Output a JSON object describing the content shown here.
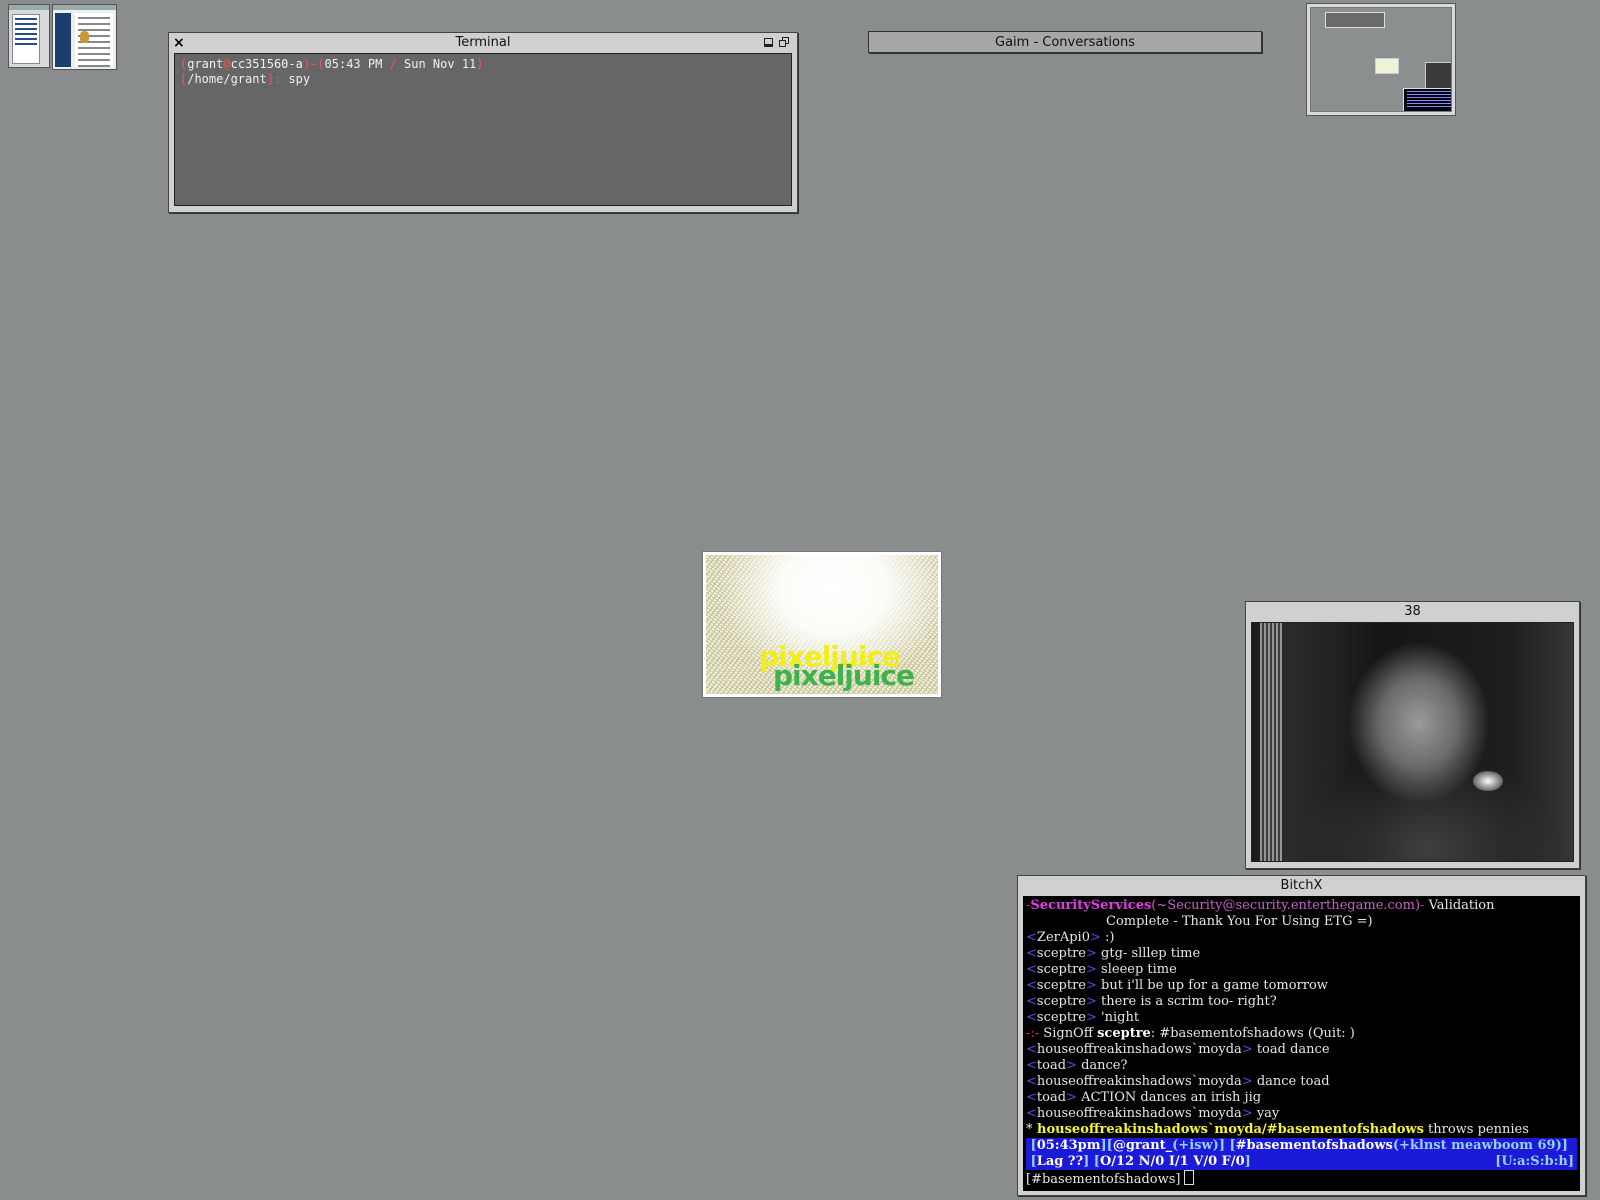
{
  "desktop": {
    "background_color": "#8a8d8e",
    "thumbnails": [
      "browser-thumbnail",
      "webpage-thumbnail"
    ]
  },
  "terminal": {
    "title": "Terminal",
    "line1": {
      "open": "(",
      "user": "grant",
      "at": "@",
      "host": "cc351560-a",
      "sep": ")-(",
      "time": "05:43 PM",
      "slash": " / ",
      "date": "Sun Nov 11",
      "close": ")"
    },
    "line2": {
      "open": "[",
      "path": "/home/grant",
      "close": "]:",
      "command": " spy"
    },
    "colors": {
      "screen": "#666666",
      "accent": "#e85a5a"
    }
  },
  "gaim": {
    "title": "Gaim - Conversations"
  },
  "pixeljuice": {
    "word1": "pixeljuice",
    "word2": "pixeljuice"
  },
  "video": {
    "title": "38"
  },
  "bitchx": {
    "title": "BitchX",
    "lines": [
      {
        "kind": "notice",
        "dash": "-",
        "nick": "SecurityServices",
        "host": "(~Security@security.enterthegame.com)",
        "dash2": "-",
        "text": " Validation"
      },
      {
        "kind": "cont",
        "text": "Complete - Thank You For Using ETG =)"
      },
      {
        "kind": "msg",
        "nick": "ZerApi0",
        "text": " :)"
      },
      {
        "kind": "msg",
        "nick": "sceptre",
        "text": " gtg- slllep time"
      },
      {
        "kind": "msg",
        "nick": "sceptre",
        "text": " sleeep time"
      },
      {
        "kind": "msg",
        "nick": "sceptre",
        "text": " but i'll be up for a game tomorrow"
      },
      {
        "kind": "msg",
        "nick": "sceptre",
        "text": " there is a scrim too- right?"
      },
      {
        "kind": "msg",
        "nick": "sceptre",
        "text": " 'night"
      },
      {
        "kind": "signoff",
        "prefix": "-:-",
        "label": " SignOff ",
        "nick": "sceptre",
        "text": ": #basementofshadows ",
        "quit": "(Quit: )"
      },
      {
        "kind": "msg",
        "nick": "houseoffreakinshadows`moyda",
        "text": " toad dance"
      },
      {
        "kind": "msg",
        "nick": "toad",
        "text": " dance?"
      },
      {
        "kind": "msg",
        "nick": "houseoffreakinshadows`moyda",
        "text": " dance toad"
      },
      {
        "kind": "msg",
        "nick": "toad",
        "text": " ACTION dances an irish jig"
      },
      {
        "kind": "msg",
        "nick": "houseoffreakinshadows`moyda",
        "text": " yay"
      },
      {
        "kind": "action",
        "star": "*",
        "who": " houseoffreakinshadows`moyda/#basementofshadows",
        "text": " throws pennies"
      }
    ],
    "status1": {
      "time": "05:43pm",
      "nick": "@grant_",
      "umode": "(+isw)",
      "channel": "#basementofshadows",
      "cmode": "(+klnst meawboom 69)"
    },
    "status2": {
      "lag": "Lag ??",
      "counts": "O/12 N/0 I/1 V/0 F/0",
      "flags": "[U:a:S:b:h]"
    },
    "input": "[#basementofshadows]",
    "colors": {
      "status_bg": "#1a1ad8",
      "nick_brackets": "#5050e0",
      "highlight": "#e33be3"
    }
  }
}
